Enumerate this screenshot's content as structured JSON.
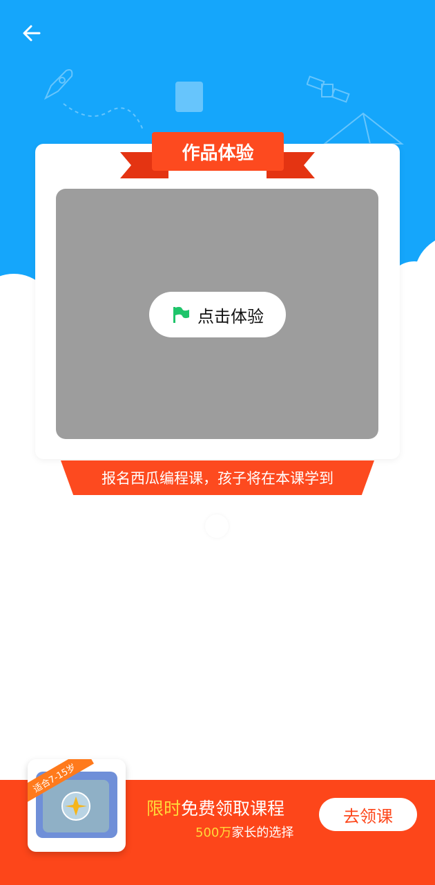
{
  "header": {
    "back_icon": "arrow-left-icon"
  },
  "card": {
    "title": "作品体验",
    "try_button_label": "点击体验",
    "try_button_icon": "green-flag-icon"
  },
  "learn_banner": {
    "text": "报名西瓜编程课，孩子将在本课学到"
  },
  "promo": {
    "age_badge": "适合7-15岁",
    "title_highlight": "限时",
    "title_rest": "免费领取课程",
    "subtitle_highlight": "500万",
    "subtitle_rest": "家长的选择",
    "button_label": "去领课"
  },
  "colors": {
    "hero_blue": "#15a6fb",
    "accent_orange": "#fd4a1f",
    "flag_green": "#1ec46a",
    "highlight_yellow": "#ffd93a"
  }
}
